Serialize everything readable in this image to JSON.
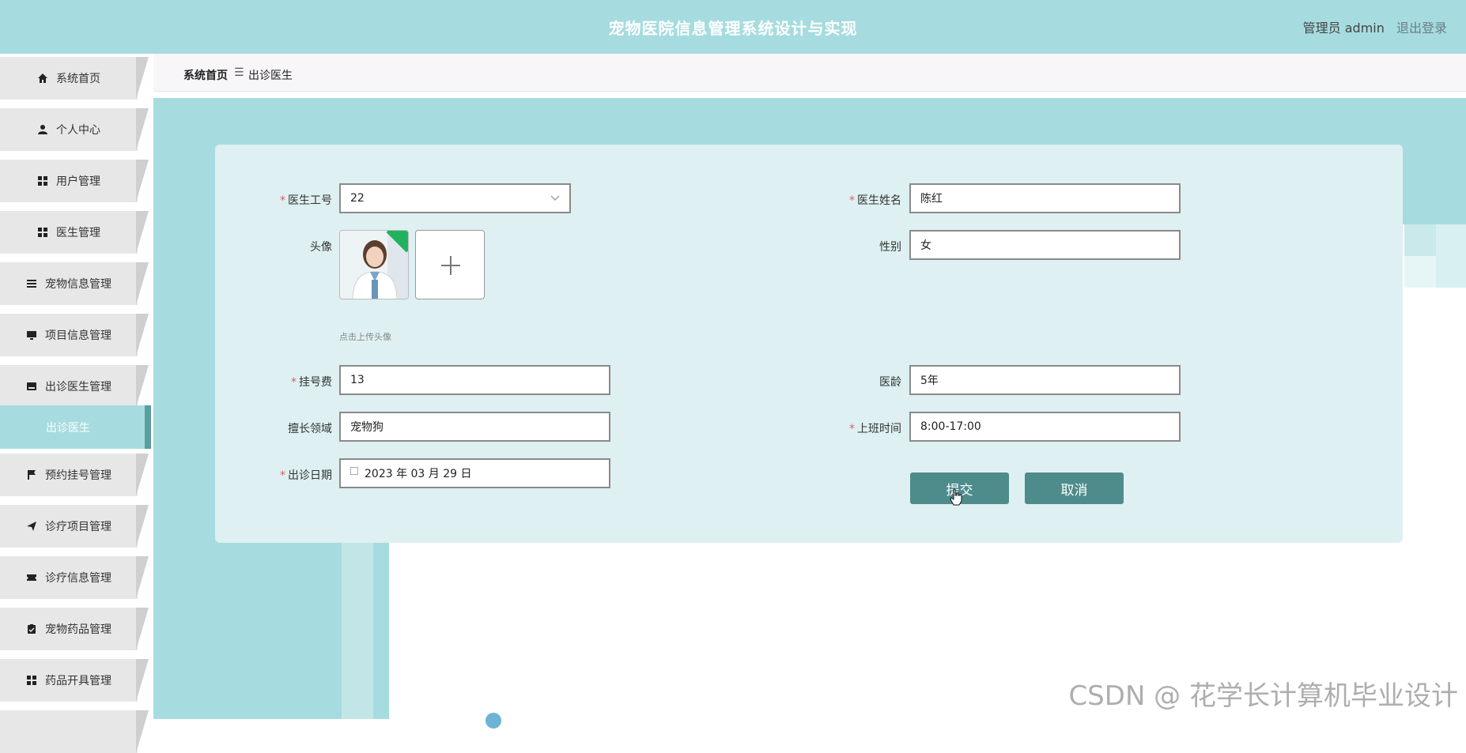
{
  "header": {
    "title": "宠物医院信息管理系统设计与实现",
    "user_label": "管理员 admin",
    "logout_label": "退出登录"
  },
  "sidebar": {
    "items": [
      {
        "label": "系统首页",
        "icon": "home-icon"
      },
      {
        "label": "个人中心",
        "icon": "user-icon"
      },
      {
        "label": "用户管理",
        "icon": "grid-icon"
      },
      {
        "label": "医生管理",
        "icon": "grid-icon"
      },
      {
        "label": "宠物信息管理",
        "icon": "list-icon"
      },
      {
        "label": "项目信息管理",
        "icon": "monitor-icon"
      },
      {
        "label": "出诊医生管理",
        "icon": "inbox-icon"
      },
      {
        "label": "预约挂号管理",
        "icon": "flag-icon"
      },
      {
        "label": "诊疗项目管理",
        "icon": "send-icon"
      },
      {
        "label": "诊疗信息管理",
        "icon": "ticket-icon"
      },
      {
        "label": "宠物药品管理",
        "icon": "clipboard-icon"
      },
      {
        "label": "药品开具管理",
        "icon": "grid-icon"
      }
    ],
    "active_sub": "出诊医生"
  },
  "breadcrumb": {
    "home": "系统首页",
    "separator": "☰",
    "current": "出诊医生"
  },
  "form": {
    "doctor_id": {
      "label": "医生工号",
      "value": "22"
    },
    "doctor_name": {
      "label": "医生姓名",
      "value": "陈红"
    },
    "avatar": {
      "label": "头像",
      "hint": "点击上传头像"
    },
    "gender": {
      "label": "性别",
      "value": "女"
    },
    "fee": {
      "label": "挂号费",
      "value": "13"
    },
    "experience": {
      "label": "医龄",
      "value": "5年"
    },
    "specialty": {
      "label": "擅长领域",
      "value": "宠物狗"
    },
    "work_time": {
      "label": "上班时间",
      "value": "8:00-17:00"
    },
    "visit_date": {
      "label": "出诊日期",
      "value": "2023 年 03 月 29 日"
    },
    "submit_label": "提交",
    "cancel_label": "取消"
  },
  "watermark": "CSDN @ 花学长计算机毕业设计",
  "colors": {
    "header_bg": "#a6dcdf",
    "panel_bg": "#def0f1",
    "button_bg": "#4e8c8c",
    "required": "#e05b5b"
  }
}
